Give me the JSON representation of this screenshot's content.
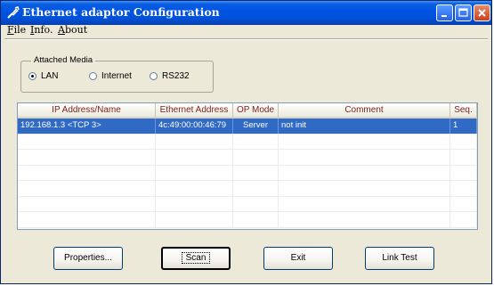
{
  "window": {
    "title": "Ethernet adaptor Configuration"
  },
  "menu": [
    {
      "accel": "F",
      "rest": "ile"
    },
    {
      "accel": "I",
      "rest": "nfo."
    },
    {
      "accel": "A",
      "rest": "bout"
    }
  ],
  "attached_media": {
    "legend": "Attached Media",
    "options": [
      {
        "label": "LAN",
        "selected": true
      },
      {
        "label": "Internet",
        "selected": false
      },
      {
        "label": "RS232",
        "selected": false
      }
    ]
  },
  "table": {
    "columns": [
      "IP Address/Name",
      "Ethernet Address",
      "OP Mode",
      "Comment",
      "Seq."
    ],
    "rows": [
      [
        "192.168.1.3 <TCP 3>",
        "4c:49:00:00:46:79",
        "Server",
        "not init",
        "1"
      ],
      [
        "",
        "",
        "",
        "",
        ""
      ],
      [
        "",
        "",
        "",
        "",
        ""
      ],
      [
        "",
        "",
        "",
        "",
        ""
      ],
      [
        "",
        "",
        "",
        "",
        ""
      ],
      [
        "",
        "",
        "",
        "",
        ""
      ],
      [
        "",
        "",
        "",
        "",
        ""
      ]
    ],
    "selected_row": 0
  },
  "buttons": {
    "properties": "Properties...",
    "scan": "Scan",
    "exit": "Exit",
    "link_test": "Link Test"
  },
  "colors": {
    "titlebar": "#0054e3",
    "selection": "#316ac5",
    "header_text": "#7b1f1f"
  }
}
